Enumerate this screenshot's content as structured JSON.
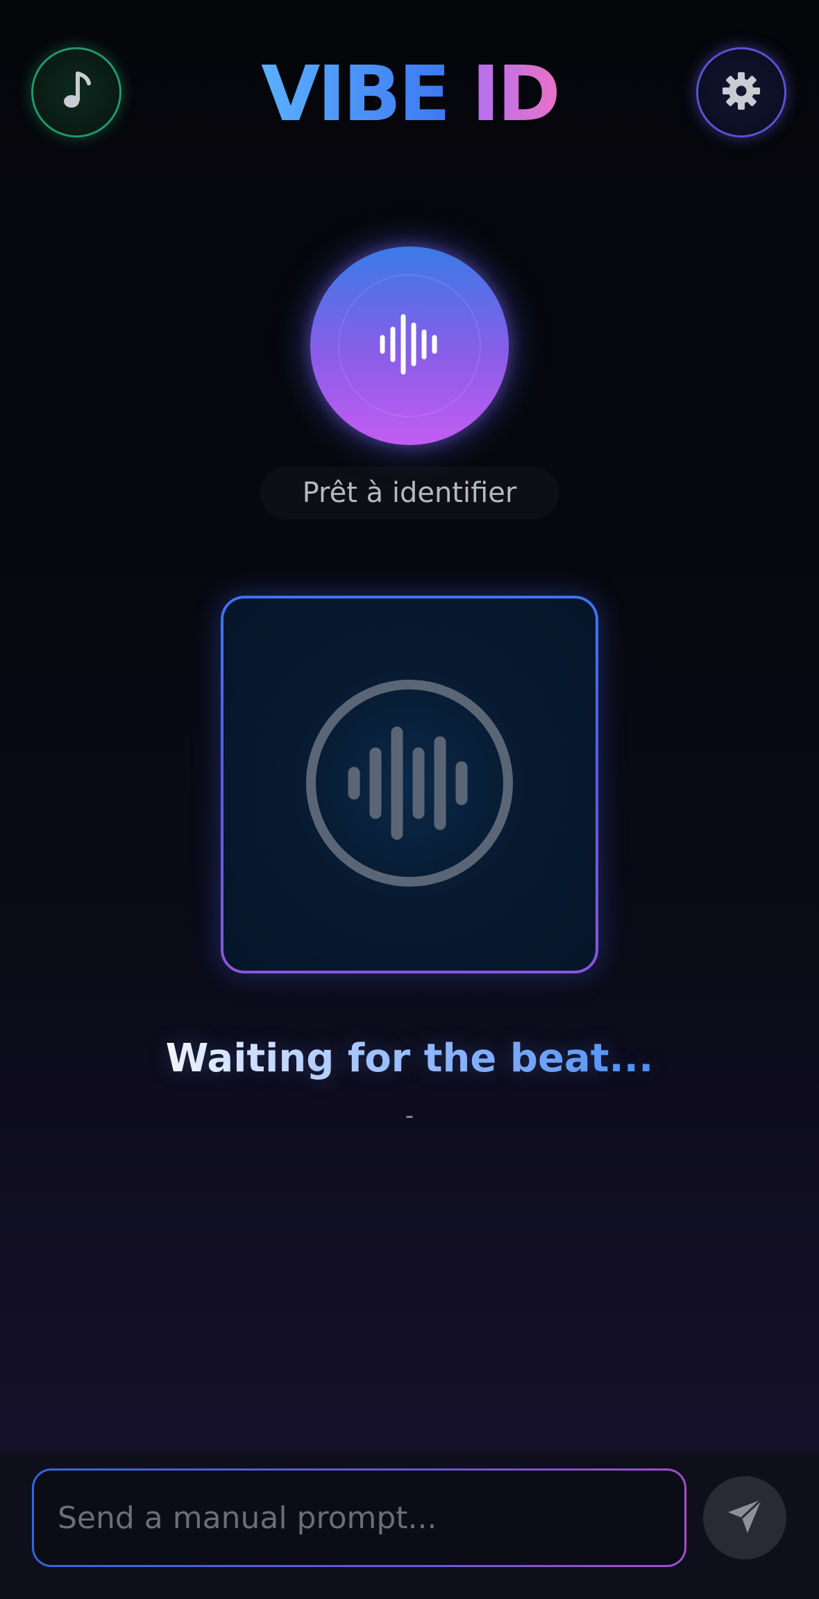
{
  "header": {
    "logo_part1": "VIBE",
    "logo_part2": "ID",
    "music_icon": "music-note-icon",
    "settings_icon": "gear-icon"
  },
  "identify": {
    "icon": "sound-wave-icon",
    "status": "Prêt à identifier"
  },
  "now_playing": {
    "artwork_icon": "audio-wave-circle-icon",
    "title": "Waiting for the beat...",
    "artist": "-"
  },
  "prompt": {
    "placeholder": "Send a manual prompt...",
    "value": "",
    "send_icon": "paper-plane-icon"
  },
  "colors": {
    "accent_blue": "#3d78f0",
    "accent_purple": "#c25df2",
    "music_ring": "#1f9a6b",
    "settings_ring": "#5b52d6"
  }
}
